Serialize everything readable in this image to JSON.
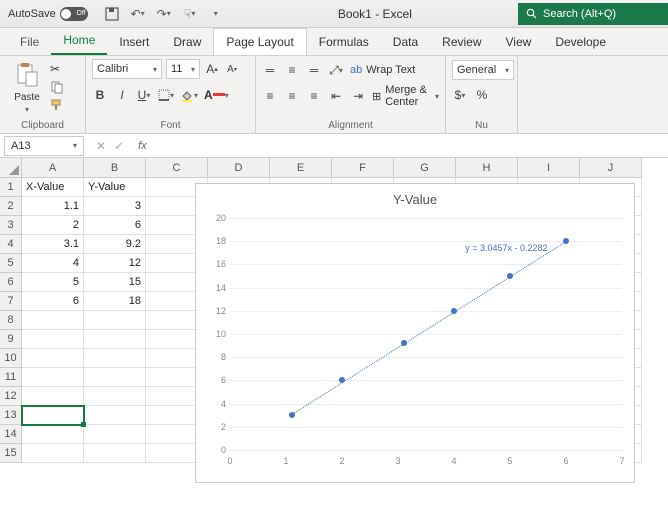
{
  "titlebar": {
    "autosave_label": "AutoSave",
    "autosave_state": "Off",
    "title": "Book1 - Excel",
    "search_placeholder": "Search (Alt+Q)"
  },
  "tabs": {
    "items": [
      "File",
      "Home",
      "Insert",
      "Draw",
      "Page Layout",
      "Formulas",
      "Data",
      "Review",
      "View",
      "Develope"
    ],
    "active": "Home",
    "selected": "Page Layout"
  },
  "ribbon": {
    "clipboard": {
      "paste": "Paste",
      "label": "Clipboard"
    },
    "font": {
      "name": "Calibri",
      "size": "11",
      "label": "Font"
    },
    "alignment": {
      "wrap": "Wrap Text",
      "merge": "Merge & Center",
      "label": "Alignment"
    },
    "number": {
      "format": "General",
      "label": "Nu",
      "currency": "$",
      "percent": "%"
    }
  },
  "namebox": "A13",
  "sheet": {
    "columns": [
      "A",
      "B",
      "C",
      "D",
      "E",
      "F",
      "G",
      "H",
      "I",
      "J"
    ],
    "rows": [
      "1",
      "2",
      "3",
      "4",
      "5",
      "6",
      "7",
      "8",
      "9",
      "10",
      "11",
      "12",
      "13",
      "14",
      "15"
    ],
    "headers": [
      "X-Value",
      "Y-Value"
    ],
    "data": [
      [
        1.1,
        3
      ],
      [
        2,
        6
      ],
      [
        3.1,
        9.2
      ],
      [
        4,
        12
      ],
      [
        5,
        15
      ],
      [
        6,
        18
      ]
    ]
  },
  "chart_data": {
    "type": "scatter",
    "title": "Y-Value",
    "x": [
      1.1,
      2,
      3.1,
      4,
      5,
      6
    ],
    "y": [
      3,
      6,
      9.2,
      12,
      15,
      18
    ],
    "xlabel": "",
    "ylabel": "",
    "xlim": [
      0,
      7
    ],
    "ylim": [
      0,
      20
    ],
    "x_ticks": [
      0,
      1,
      2,
      3,
      4,
      5,
      6,
      7
    ],
    "y_ticks": [
      0,
      2,
      4,
      6,
      8,
      10,
      12,
      14,
      16,
      18,
      20
    ],
    "trendline": {
      "equation": "y = 3.0457x - 0.2282",
      "slope": 3.0457,
      "intercept": -0.2282
    }
  }
}
